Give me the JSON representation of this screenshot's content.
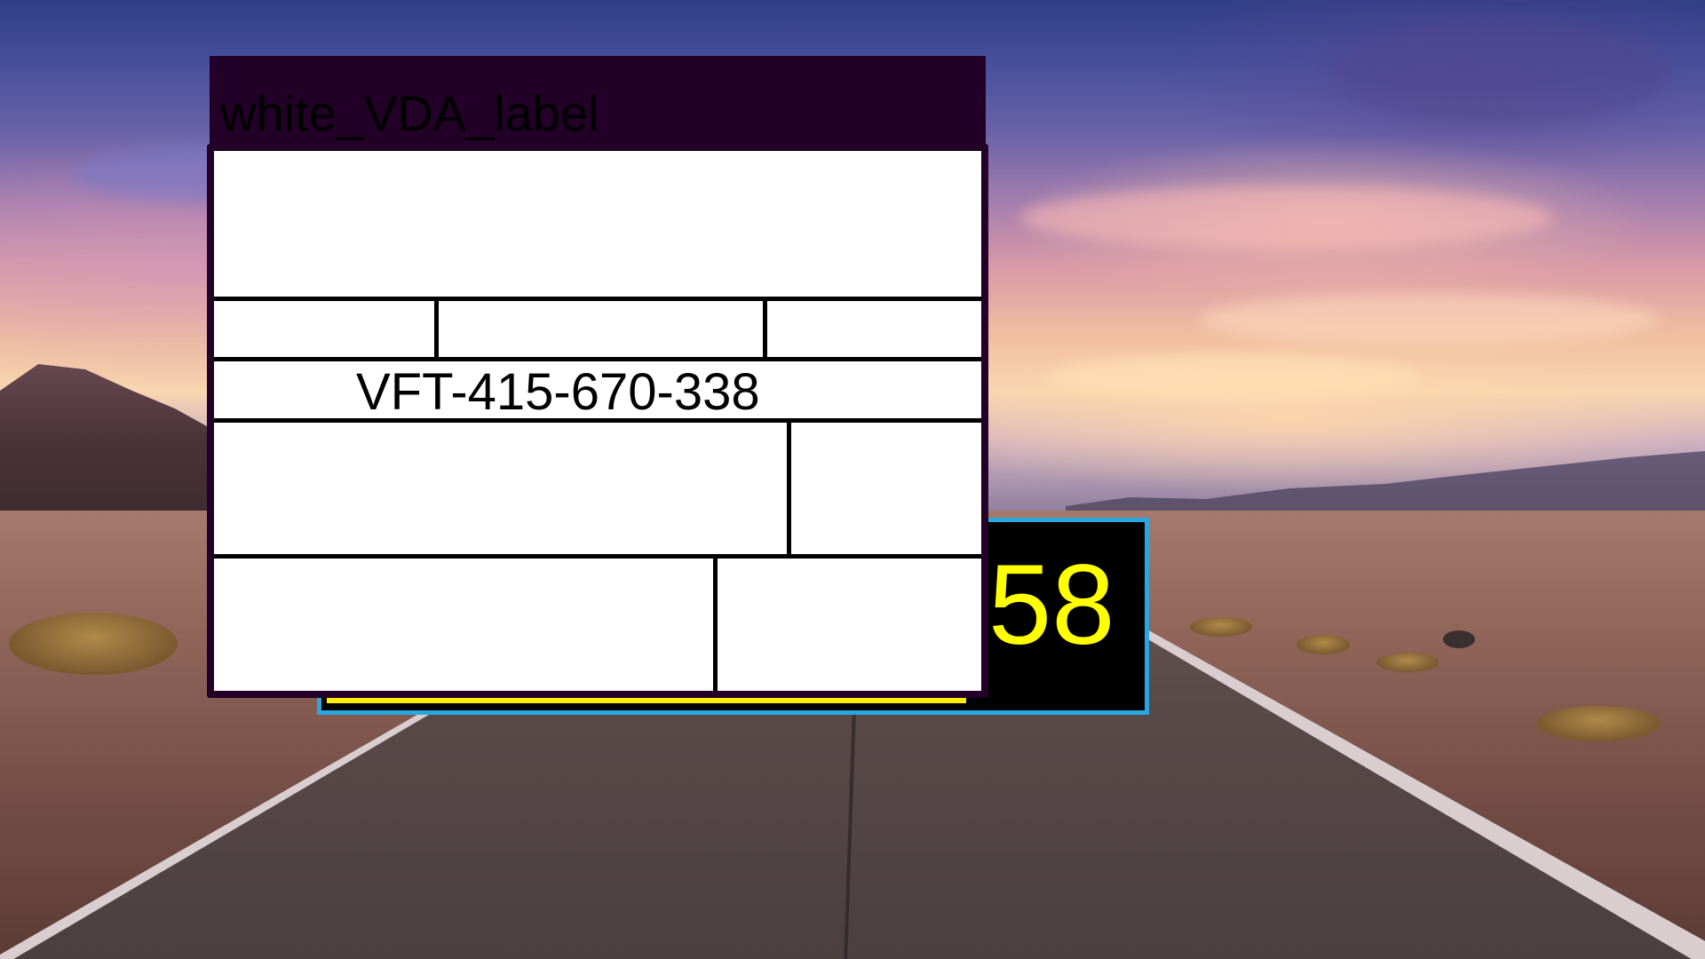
{
  "label": {
    "title": "white_VDA_label",
    "serial": "VFT-415-670-338"
  },
  "score": {
    "value": "58"
  },
  "colors": {
    "label_header": "#220027",
    "label_body": "#ffffff",
    "score_background": "#000000",
    "score_text": "#ffff00",
    "score_border": "#2aa6e0",
    "accent_strip": "#ffee00"
  }
}
